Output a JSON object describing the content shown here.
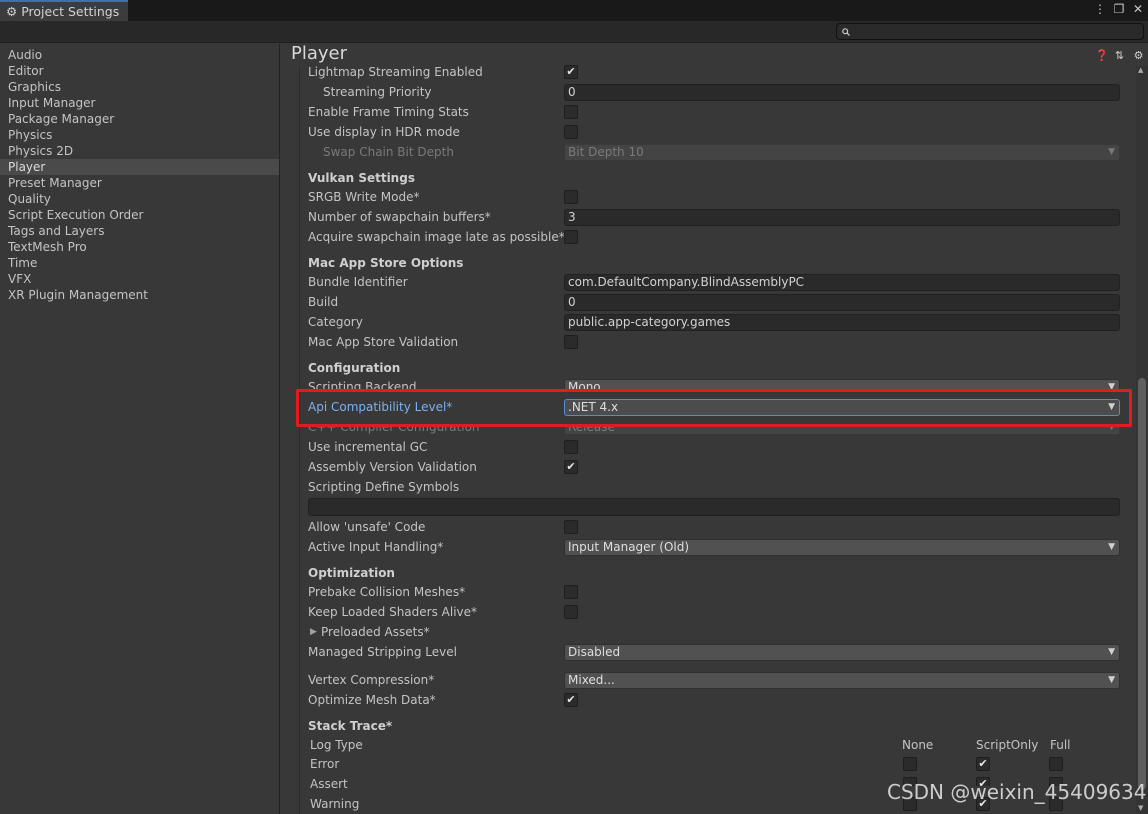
{
  "window": {
    "tab_title": "Project Settings",
    "controls": [
      "⋮",
      "❐",
      "✕"
    ]
  },
  "search": {
    "placeholder": "",
    "value": ""
  },
  "sidebar": {
    "items": [
      "Audio",
      "Editor",
      "Graphics",
      "Input Manager",
      "Package Manager",
      "Physics",
      "Physics 2D",
      "Player",
      "Preset Manager",
      "Quality",
      "Script Execution Order",
      "Tags and Layers",
      "TextMesh Pro",
      "Time",
      "VFX",
      "XR Plugin Management"
    ],
    "selected": "Player"
  },
  "main": {
    "title": "Player",
    "icons": [
      "help-icon",
      "preset-icon",
      "gear-icon"
    ],
    "rows": {
      "lightmap_streaming": {
        "label": "Lightmap Streaming Enabled",
        "checked": "✔"
      },
      "streaming_priority": {
        "label": "Streaming Priority",
        "value": "0"
      },
      "frame_timing": {
        "label": "Enable Frame Timing Stats",
        "checked": ""
      },
      "hdr_mode": {
        "label": "Use display in HDR mode",
        "checked": ""
      },
      "swap_chain": {
        "label": "Swap Chain Bit Depth",
        "value": "Bit Depth 10"
      },
      "vulkan_header": "Vulkan Settings",
      "srgb_write": {
        "label": "SRGB Write Mode*",
        "checked": ""
      },
      "swapchain_buffers": {
        "label": "Number of swapchain buffers*",
        "value": "3"
      },
      "acquire_late": {
        "label": "Acquire swapchain image late as possible*",
        "checked": ""
      },
      "mac_header": "Mac App Store Options",
      "bundle_id": {
        "label": "Bundle Identifier",
        "value": "com.DefaultCompany.BlindAssemblyPC"
      },
      "build": {
        "label": "Build",
        "value": "0"
      },
      "category": {
        "label": "Category",
        "value": "public.app-category.games"
      },
      "mac_validation": {
        "label": "Mac App Store Validation",
        "checked": ""
      },
      "config_header": "Configuration",
      "scripting_backend": {
        "label": "Scripting Backend",
        "value": "Mono"
      },
      "api_level": {
        "label": "Api Compatibility Level*",
        "value": ".NET 4.x"
      },
      "cpp_config": {
        "label": "C++ Compiler Configuration",
        "value": "Release"
      },
      "incremental_gc": {
        "label": "Use incremental GC",
        "checked": ""
      },
      "assembly_validation": {
        "label": "Assembly Version Validation",
        "checked": "✔"
      },
      "define_symbols": {
        "label": "Scripting Define Symbols",
        "value": ""
      },
      "unsafe_code": {
        "label": "Allow 'unsafe' Code",
        "checked": ""
      },
      "input_handling": {
        "label": "Active Input Handling*",
        "value": "Input Manager (Old)"
      },
      "opt_header": "Optimization",
      "prebake": {
        "label": "Prebake Collision Meshes*",
        "checked": ""
      },
      "keep_shaders": {
        "label": "Keep Loaded Shaders Alive*",
        "checked": ""
      },
      "preloaded_assets": {
        "label": "Preloaded Assets*"
      },
      "stripping": {
        "label": "Managed Stripping Level",
        "value": "Disabled"
      },
      "vertex_compression": {
        "label": "Vertex Compression*",
        "value": "Mixed..."
      },
      "optimize_mesh": {
        "label": "Optimize Mesh Data*",
        "checked": "✔"
      },
      "stack_header": "Stack Trace*"
    },
    "stack_trace": {
      "log_type_label": "Log Type",
      "columns": [
        "None",
        "ScriptOnly",
        "Full"
      ],
      "rows": [
        {
          "type": "Error",
          "none": "",
          "script_only": "✔",
          "full": ""
        },
        {
          "type": "Assert",
          "none": "",
          "script_only": "✔",
          "full": ""
        },
        {
          "type": "Warning",
          "none": "",
          "script_only": "✔",
          "full": ""
        }
      ]
    }
  },
  "highlight_color": "#e01c1c",
  "accent_color": "#7bb2f0",
  "watermark": "CSDN @weixin_45409634"
}
